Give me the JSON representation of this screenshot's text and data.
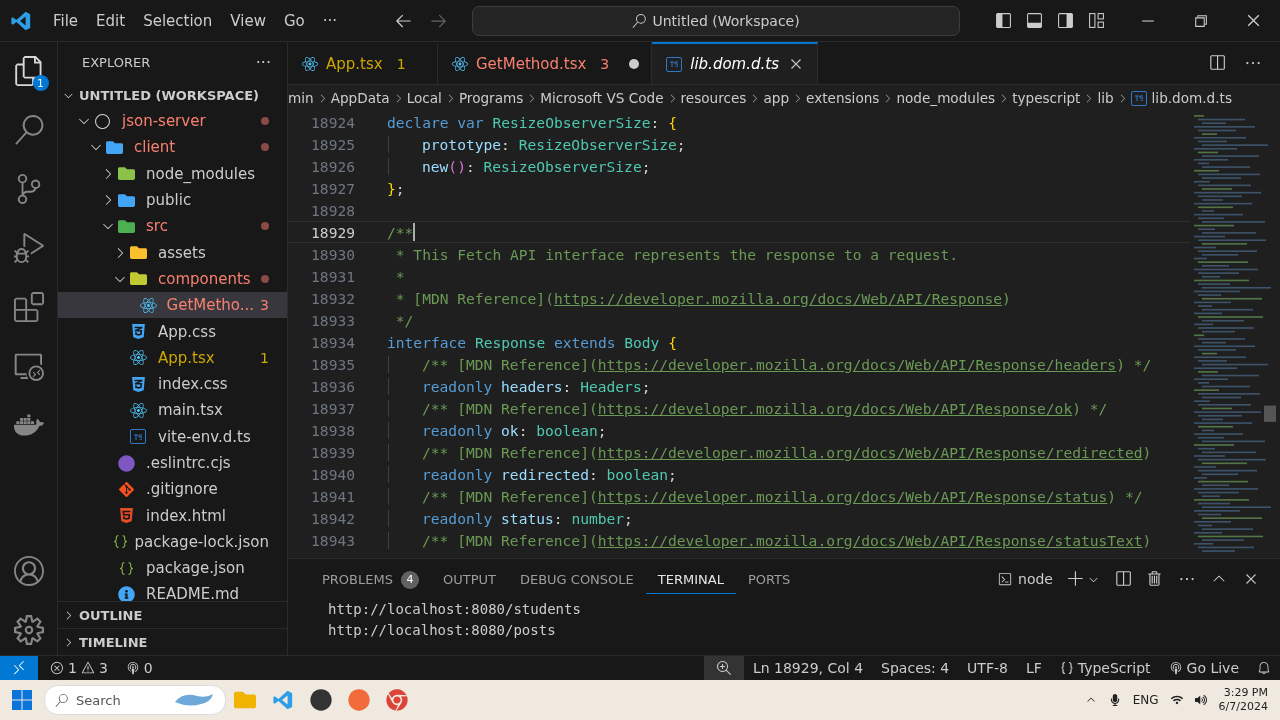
{
  "title_bar": {
    "menu": [
      "File",
      "Edit",
      "Selection",
      "View",
      "Go",
      "···"
    ],
    "command_center": "Untitled (Workspace)"
  },
  "activity_bar": {
    "explorer_badge": "1"
  },
  "sidebar": {
    "title": "EXPLORER",
    "more": "···",
    "workspace": {
      "label": "UNTITLED (WORKSPACE)",
      "expanded": true
    },
    "tree": [
      {
        "name": "json-server",
        "kind": "repo",
        "error": true,
        "warning": false,
        "expanded": true,
        "selected": false,
        "children": [
          {
            "name": "client",
            "kind": "client",
            "error": true,
            "warning": false,
            "expanded": true,
            "selected": false,
            "children": [
              {
                "name": "node_modules",
                "kind": "node",
                "error": false,
                "warning": false,
                "expanded": false,
                "selected": false
              },
              {
                "name": "public",
                "kind": "public",
                "error": false,
                "warning": false,
                "expanded": false,
                "selected": false
              },
              {
                "name": "src",
                "kind": "src",
                "error": true,
                "warning": false,
                "expanded": true,
                "selected": false,
                "children": [
                  {
                    "name": "assets",
                    "kind": "assets",
                    "error": false,
                    "warning": false,
                    "expanded": false,
                    "selected": false
                  },
                  {
                    "name": "components",
                    "kind": "components",
                    "error": true,
                    "warning": false,
                    "expanded": true,
                    "selected": false,
                    "children": [
                      {
                        "name": "GetMetho...",
                        "kind": "react",
                        "error": true,
                        "warning": false,
                        "badge": "3",
                        "selected": true
                      }
                    ]
                  },
                  {
                    "name": "App.css",
                    "kind": "css",
                    "error": false,
                    "warning": false,
                    "selected": false
                  },
                  {
                    "name": "App.tsx",
                    "kind": "react",
                    "error": false,
                    "warning": true,
                    "badge": "1",
                    "selected": false
                  },
                  {
                    "name": "index.css",
                    "kind": "css",
                    "error": false,
                    "warning": false,
                    "selected": false
                  },
                  {
                    "name": "main.tsx",
                    "kind": "react",
                    "error": false,
                    "warning": false,
                    "selected": false
                  },
                  {
                    "name": "vite-env.d.ts",
                    "kind": "ts",
                    "error": false,
                    "warning": false,
                    "selected": false
                  }
                ]
              },
              {
                "name": ".eslintrc.cjs",
                "kind": "eslint",
                "error": false,
                "warning": false,
                "selected": false
              },
              {
                "name": ".gitignore",
                "kind": "git",
                "error": false,
                "warning": false,
                "selected": false
              },
              {
                "name": "index.html",
                "kind": "html",
                "error": false,
                "warning": false,
                "selected": false
              },
              {
                "name": "package-lock.json",
                "kind": "json",
                "error": false,
                "warning": false,
                "selected": false
              },
              {
                "name": "package.json",
                "kind": "json",
                "error": false,
                "warning": false,
                "selected": false
              },
              {
                "name": "README.md",
                "kind": "info",
                "error": false,
                "warning": false,
                "selected": false
              }
            ]
          }
        ]
      }
    ],
    "sections": [
      {
        "label": "OUTLINE",
        "expanded": false
      },
      {
        "label": "TIMELINE",
        "expanded": false
      }
    ]
  },
  "tabs": [
    {
      "label": "App.tsx",
      "kind": "react",
      "error": false,
      "warning": true,
      "badge": "1",
      "dirty": false,
      "selected": false
    },
    {
      "label": "GetMethod.tsx",
      "kind": "react",
      "error": true,
      "warning": false,
      "badge": "3",
      "dirty": true,
      "selected": false
    },
    {
      "label": "lib.dom.d.ts",
      "kind": "ts",
      "error": false,
      "warning": false,
      "dirty": false,
      "selected": true
    }
  ],
  "breadcrumbs": [
    "min",
    "AppData",
    "Local",
    "Programs",
    "Microsoft VS Code",
    "resources",
    "app",
    "extensions",
    "node_modules",
    "typescript",
    "lib",
    "lib.dom.d.ts"
  ],
  "editor": {
    "lines": [
      {
        "number": "18924",
        "indented": false,
        "current": false,
        "tokens": [
          {
            "kind": "kw",
            "text": "declare var "
          },
          {
            "kind": "type",
            "text": "ResizeObserverSize"
          },
          {
            "kind": "plain",
            "text": ": "
          },
          {
            "kind": "brace",
            "text": "{"
          }
        ]
      },
      {
        "number": "18925",
        "indented": true,
        "current": false,
        "tokens": [
          {
            "kind": "prop",
            "text": "prototype"
          },
          {
            "kind": "plain",
            "text": ": "
          },
          {
            "kind": "type",
            "text": "ResizeObserverSize"
          },
          {
            "kind": "plain",
            "text": ";"
          }
        ]
      },
      {
        "number": "18926",
        "indented": true,
        "current": false,
        "tokens": [
          {
            "kind": "prop",
            "text": "new"
          },
          {
            "kind": "paren",
            "text": "()"
          },
          {
            "kind": "plain",
            "text": ": "
          },
          {
            "kind": "type",
            "text": "ResizeObserverSize"
          },
          {
            "kind": "plain",
            "text": ";"
          }
        ]
      },
      {
        "number": "18927",
        "indented": false,
        "current": false,
        "tokens": [
          {
            "kind": "brace",
            "text": "}"
          },
          {
            "kind": "plain",
            "text": ";"
          }
        ]
      },
      {
        "number": "18928",
        "current": false
      },
      {
        "number": "18929",
        "indented": false,
        "current": true,
        "tokens": [
          {
            "kind": "comment",
            "text": "/**"
          }
        ]
      },
      {
        "number": "18930",
        "indented": false,
        "current": false,
        "tokens": [
          {
            "kind": "comment",
            "text": " * This Fetch API interface represents the response to a request."
          }
        ]
      },
      {
        "number": "18931",
        "indented": false,
        "current": false,
        "tokens": [
          {
            "kind": "comment",
            "text": " *"
          }
        ]
      },
      {
        "number": "18932",
        "indented": false,
        "current": false,
        "tokens": [
          {
            "kind": "comment",
            "text": " * [MDN Reference]("
          },
          {
            "kind": "link",
            "text": "https://developer.mozilla.org/docs/Web/API/Response"
          },
          {
            "kind": "comment",
            "text": ")"
          }
        ]
      },
      {
        "number": "18933",
        "indented": false,
        "current": false,
        "tokens": [
          {
            "kind": "comment",
            "text": " */"
          }
        ]
      },
      {
        "number": "18934",
        "indented": false,
        "current": false,
        "tokens": [
          {
            "kind": "kw",
            "text": "interface "
          },
          {
            "kind": "type",
            "text": "Response "
          },
          {
            "kind": "kw",
            "text": "extends "
          },
          {
            "kind": "type",
            "text": "Body "
          },
          {
            "kind": "brace",
            "text": "{"
          }
        ]
      },
      {
        "number": "18935",
        "indented": true,
        "current": false,
        "tokens": [
          {
            "kind": "comment",
            "text": "/** [MDN Reference]("
          },
          {
            "kind": "link",
            "text": "https://developer.mozilla.org/docs/Web/API/Response/headers"
          },
          {
            "kind": "comment",
            "text": ") */"
          }
        ]
      },
      {
        "number": "18936",
        "indented": true,
        "current": false,
        "tokens": [
          {
            "kind": "kw",
            "text": "readonly "
          },
          {
            "kind": "prop",
            "text": "headers"
          },
          {
            "kind": "plain",
            "text": ": "
          },
          {
            "kind": "type",
            "text": "Headers"
          },
          {
            "kind": "plain",
            "text": ";"
          }
        ]
      },
      {
        "number": "18937",
        "indented": true,
        "current": false,
        "tokens": [
          {
            "kind": "comment",
            "text": "/** [MDN Reference]("
          },
          {
            "kind": "link",
            "text": "https://developer.mozilla.org/docs/Web/API/Response/ok"
          },
          {
            "kind": "comment",
            "text": ") */"
          }
        ]
      },
      {
        "number": "18938",
        "indented": true,
        "current": false,
        "tokens": [
          {
            "kind": "kw",
            "text": "readonly "
          },
          {
            "kind": "prop",
            "text": "ok"
          },
          {
            "kind": "plain",
            "text": ": "
          },
          {
            "kind": "type",
            "text": "boolean"
          },
          {
            "kind": "plain",
            "text": ";"
          }
        ]
      },
      {
        "number": "18939",
        "indented": true,
        "current": false,
        "tokens": [
          {
            "kind": "comment",
            "text": "/** [MDN Reference]("
          },
          {
            "kind": "link",
            "text": "https://developer.mozilla.org/docs/Web/API/Response/redirected"
          },
          {
            "kind": "comment",
            "text": ")"
          }
        ]
      },
      {
        "number": "18940",
        "indented": true,
        "current": false,
        "tokens": [
          {
            "kind": "kw",
            "text": "readonly "
          },
          {
            "kind": "prop",
            "text": "redirected"
          },
          {
            "kind": "plain",
            "text": ": "
          },
          {
            "kind": "type",
            "text": "boolean"
          },
          {
            "kind": "plain",
            "text": ";"
          }
        ]
      },
      {
        "number": "18941",
        "indented": true,
        "current": false,
        "tokens": [
          {
            "kind": "comment",
            "text": "/** [MDN Reference]("
          },
          {
            "kind": "link",
            "text": "https://developer.mozilla.org/docs/Web/API/Response/status"
          },
          {
            "kind": "comment",
            "text": ") */"
          }
        ]
      },
      {
        "number": "18942",
        "indented": true,
        "current": false,
        "tokens": [
          {
            "kind": "kw",
            "text": "readonly "
          },
          {
            "kind": "prop",
            "text": "status"
          },
          {
            "kind": "plain",
            "text": ": "
          },
          {
            "kind": "type",
            "text": "number"
          },
          {
            "kind": "plain",
            "text": ";"
          }
        ]
      },
      {
        "number": "18943",
        "indented": true,
        "current": false,
        "tokens": [
          {
            "kind": "comment",
            "text": "/** [MDN Reference]("
          },
          {
            "kind": "link",
            "text": "https://developer.mozilla.org/docs/Web/API/Response/statusText"
          },
          {
            "kind": "comment",
            "text": ")"
          }
        ]
      }
    ]
  },
  "panel": {
    "tabs": [
      {
        "label": "PROBLEMS",
        "badge": "4",
        "selected": false
      },
      {
        "label": "OUTPUT",
        "selected": false
      },
      {
        "label": "DEBUG CONSOLE",
        "selected": false
      },
      {
        "label": "TERMINAL",
        "selected": true
      },
      {
        "label": "PORTS",
        "selected": false
      }
    ],
    "terminal_name": "node",
    "terminal_lines": [
      "http://localhost:8080/students",
      "http://localhost:8080/posts"
    ]
  },
  "status_bar": {
    "errors": "1",
    "warnings": "3",
    "ports": "0",
    "items": [
      {
        "kind": "position",
        "text": "Ln 18929, Col 4"
      },
      {
        "kind": "plain",
        "text": "Spaces: 4"
      },
      {
        "kind": "plain",
        "text": "UTF-8"
      },
      {
        "kind": "plain",
        "text": "LF"
      },
      {
        "kind": "language",
        "text": "TypeScript"
      },
      {
        "kind": "live",
        "text": "Go Live"
      }
    ]
  },
  "taskbar": {
    "search_placeholder": "Search",
    "language": "ENG",
    "time": "3:29 PM",
    "date": "6/7/2024"
  }
}
